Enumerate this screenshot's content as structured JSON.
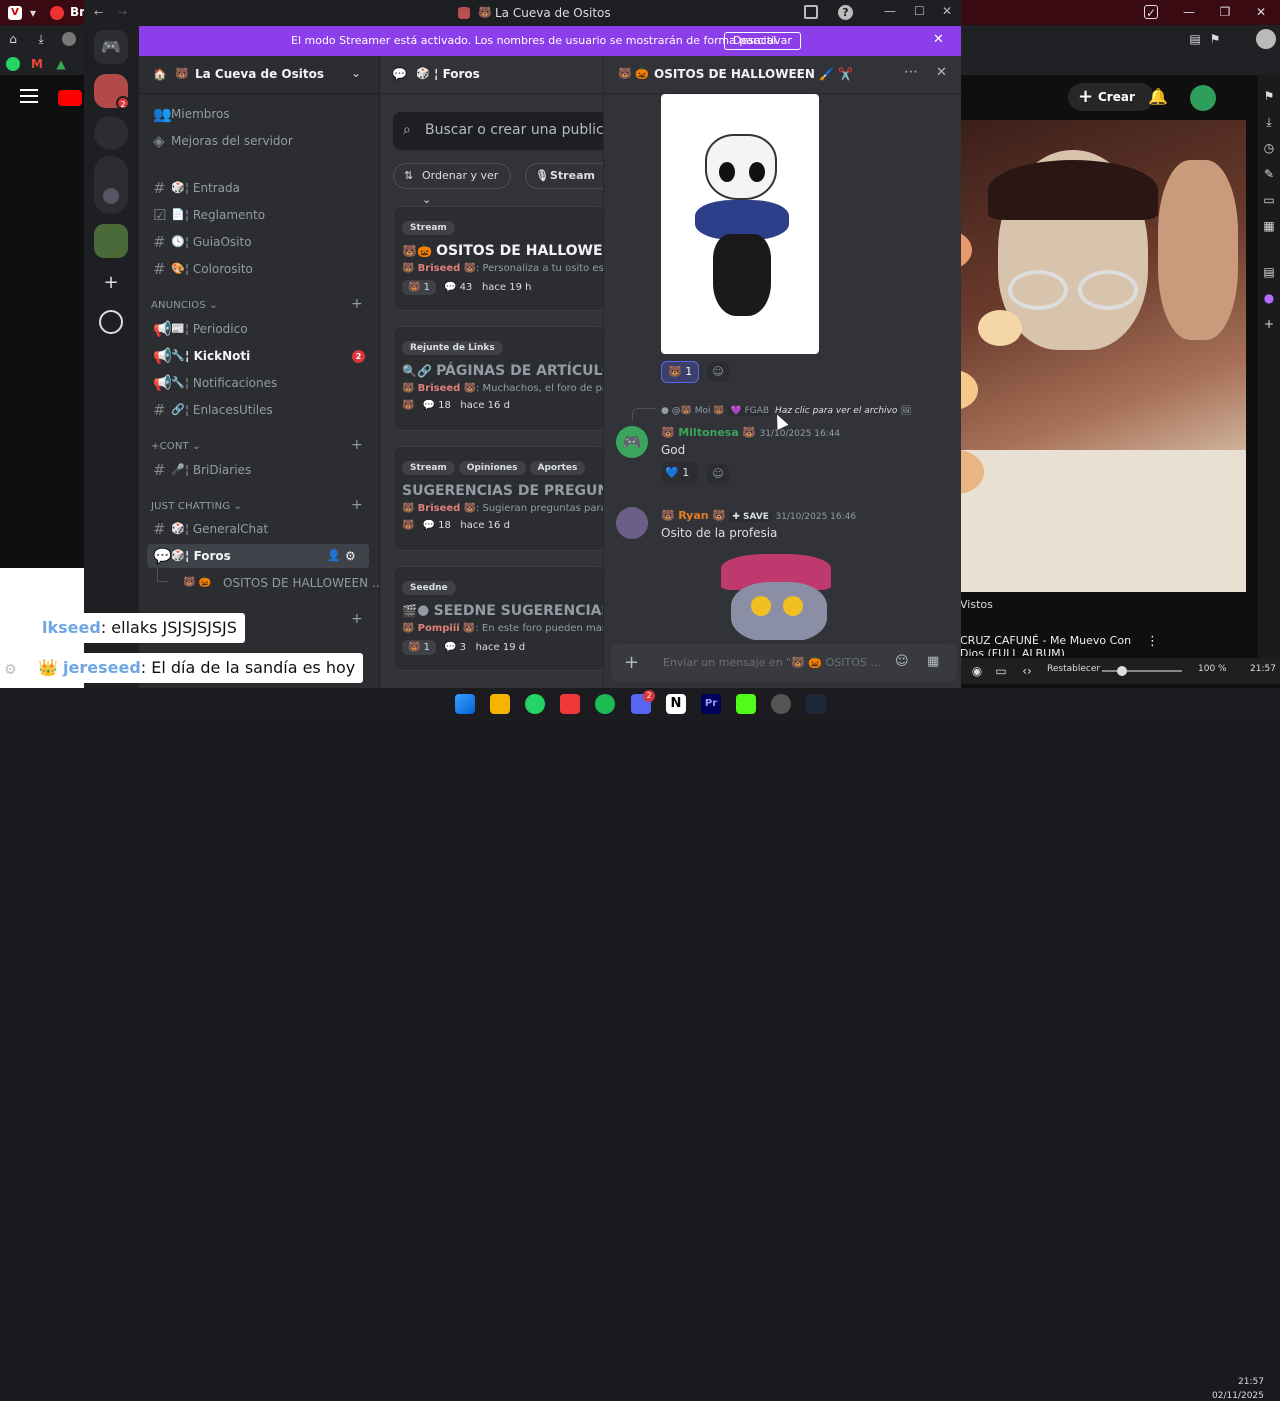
{
  "window_title": "La Cueva de Ositos",
  "bg_tab_label": "Bri",
  "streamer_banner": {
    "text": "El modo Streamer está activado. Los nombres de usuario se mostrarán de forma parcial.",
    "button": "Desactivar"
  },
  "server": {
    "name": "La Cueva de Ositos",
    "top_items": [
      "Miembros",
      "Mejoras del servidor"
    ],
    "channels_top": [
      {
        "label": "Entrada"
      },
      {
        "label": "Reglamento"
      },
      {
        "label": "GuiaOsito"
      },
      {
        "label": "Colorosito"
      }
    ],
    "category_anuncios": "ANUNCIOS",
    "channels_anuncios": [
      {
        "label": "Periodico"
      },
      {
        "label": "KickNoti",
        "badge": "2"
      },
      {
        "label": "Notificaciones"
      },
      {
        "label": "EnlacesUtiles"
      }
    ],
    "category_cont": "+CONT",
    "channels_cont": [
      {
        "label": "BriDiaries"
      }
    ],
    "category_just": "JUST CHATTING",
    "channels_just": [
      {
        "label": "GeneralChat"
      },
      {
        "label": "Foros"
      }
    ],
    "thread_item": "OSITOS DE HALLOWEEN ..."
  },
  "forum": {
    "title": "Foros",
    "search_placeholder": "Buscar o crear una publicación",
    "sort_label": "Ordenar y ver",
    "filter_tag": "Stream",
    "posts": [
      {
        "tags": [
          "Stream"
        ],
        "title": "OSITOS DE HALLOWEEN",
        "author": "Briseed",
        "preview": ": Personaliza a tu osito este",
        "count_react": "1",
        "count_msgs": "43",
        "time": "hace 19 h"
      },
      {
        "tags": [
          "Rejunte de Links"
        ],
        "title": "PÁGINAS DE ARTÍCULOS",
        "author": "Briseed",
        "preview": ": Muchachos, el foro de pa",
        "count_react": "",
        "count_msgs": "18",
        "time": "hace 16 d"
      },
      {
        "tags": [
          "Stream",
          "Opiniones",
          "Aportes"
        ],
        "title": "SUGERENCIAS DE PREGUNTAS",
        "author": "Briseed",
        "preview": ": Sugieran preguntas para",
        "count_react": "",
        "count_msgs": "18",
        "time": "hace 16 d"
      },
      {
        "tags": [
          "Seedne"
        ],
        "title": "SEEDNE SUGERENCIAS",
        "author": "Pompiii",
        "preview": ": En este foro pueden manc",
        "count_react": "1",
        "count_msgs": "3",
        "time": "hace 19 d"
      }
    ]
  },
  "thread": {
    "title": "OSITOS DE HALLOWEEN",
    "reaction_count": "1",
    "reply_user": "Moi",
    "reply_tag": "FGAB",
    "reply_text": "Haz clic para ver el archivo",
    "messages": [
      {
        "user": "Miltonesa",
        "time": "31/10/2025 16:44",
        "text": "God",
        "reaction": "1",
        "name_color": "#3ba55d"
      },
      {
        "user": "Ryan",
        "tag": "SAVE",
        "time": "31/10/2025 16:46",
        "text": "Osito de la profesia",
        "name_color": "#e67e22"
      }
    ],
    "composer_placeholder": "Enviar un mensaje en \"🐻 🎃 OSITOS ..."
  },
  "right_browser": {
    "create_label": "Crear",
    "vistos_label": "Vistos",
    "song_title": "CRUZ CAFUNÉ - Me Muevo Con Dios (FULL ALBUM)",
    "status_reset": "Restablecer",
    "zoom": "100 %",
    "status_time": "21:57"
  },
  "chat_overlay": [
    {
      "nick": "lkseed",
      "text": ": ellaks JSJSJSJSJS"
    },
    {
      "nick": "jereseed",
      "text": ": El día de la sandía es hoy"
    }
  ],
  "taskbar": {
    "time": "21:57",
    "date": "02/11/2025",
    "discord_badge": "2"
  },
  "colors": {
    "banner": "#8c3eea",
    "mention_badge": "#da373c",
    "discord_blurple": "#5865f2"
  }
}
